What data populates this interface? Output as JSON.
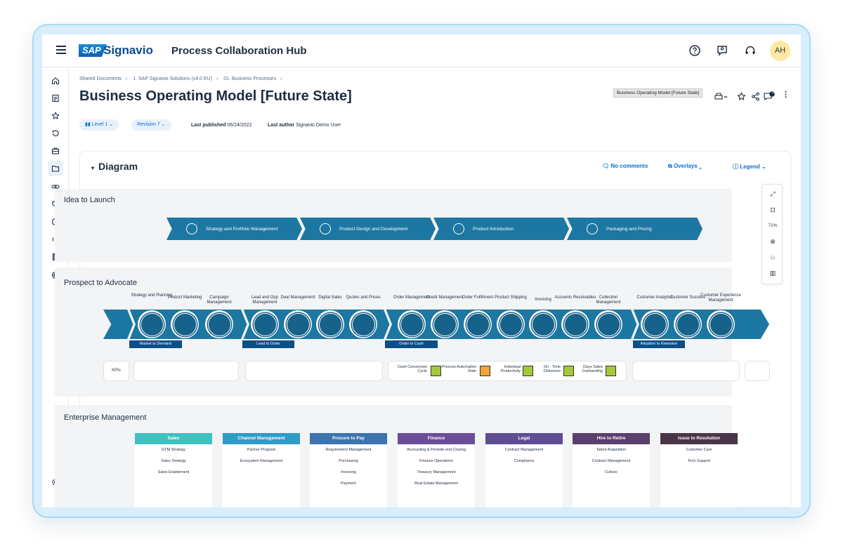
{
  "app": {
    "logo": "SAP",
    "brand": "Signavio",
    "title": "Process Collaboration Hub",
    "user_initials": "AH"
  },
  "header_icons": [
    "help-icon",
    "feedback-icon",
    "support-headset-icon"
  ],
  "sidebar_icons": [
    "home-icon",
    "document-icon",
    "star-icon",
    "history-icon",
    "briefcase-icon",
    "folder-icon",
    "link-icon",
    "search-analysis-icon",
    "dashboard-icon",
    "broadcast-icon",
    "book-icon",
    "globe-icon",
    "settings-icon"
  ],
  "breadcrumb": [
    "Shared Documents",
    "1. SAP Signavio Solutions (v4.0 EU)",
    "01. Business Processes"
  ],
  "page": {
    "title": "Business Operating Model [Future State]",
    "level_label": "Level",
    "level_value": "1",
    "revision_label": "Revision",
    "revision_value": "7",
    "published_label": "Last published",
    "published_value": "06/24/2022",
    "author_label": "Last author",
    "author_value": "Signavio Demo User",
    "tooltip": "Business Operating Model [Future State]",
    "comment_count": "0"
  },
  "diagram": {
    "heading": "Diagram",
    "comments": "No comments",
    "overlays": "Overlays",
    "legend": "Legend",
    "zoom": "71%"
  },
  "idea_to_launch": {
    "title": "Idea to Launch",
    "steps": [
      "Strategy and Portfolio Management",
      "Product Design and Development",
      "Product Introduction",
      "Packaging and Pricing"
    ]
  },
  "prospect_to_advocate": {
    "title": "Prospect to Advocate",
    "processes": [
      "Strategy and Planning",
      "Product Marketing",
      "Campaign Management",
      "Lead and Opp Management",
      "Deal Management",
      "Digital Sales",
      "Quotes and Prices",
      "Order Management",
      "Credit Management",
      "Order Fulfillment",
      "Product Shipping",
      "Invoicing",
      "Accounts Receivables",
      "Collection Management",
      "Customer Analytics",
      "Customer Success",
      "Customer Experience Management"
    ],
    "tags": [
      "Market to Demand",
      "Lead to Order",
      "Order to Cash",
      "Adoption to Retention"
    ],
    "kpi_label": "KPIs",
    "kpis": [
      {
        "name": "Cash Conversion Cycle",
        "status": "ok"
      },
      {
        "name": "Process Automation Rate",
        "status": "warning"
      },
      {
        "name": "Individual Productivity",
        "status": "ok"
      },
      {
        "name": "On - Time Deliveries",
        "status": "ok"
      },
      {
        "name": "Days Sales Outstanding",
        "status": "ok"
      }
    ]
  },
  "enterprise_management": {
    "title": "Enterprise Management",
    "columns": [
      {
        "title": "Sales",
        "color": "#3fc1c0",
        "items": [
          "GTM Strategy",
          "Sales Strategy",
          "Sales Enablement"
        ]
      },
      {
        "title": "Channel Management",
        "color": "#2d9cc8",
        "items": [
          "Partner Program",
          "Ecosystem Management"
        ]
      },
      {
        "title": "Procure to Pay",
        "color": "#3b74b0",
        "items": [
          "Requirement Management",
          "Purchasing",
          "Invoicing",
          "Payment"
        ]
      },
      {
        "title": "Finance",
        "color": "#6b4d9a",
        "items": [
          "Accounting & Periode-end Closing",
          "Finance Operations",
          "Treasury Management",
          "Real Estate Management"
        ]
      },
      {
        "title": "Legal",
        "color": "#5f4d94",
        "items": [
          "Contract Management",
          "Compliance"
        ]
      },
      {
        "title": "Hire to Retire",
        "color": "#5b3f6e",
        "items": [
          "Talent Acquisition",
          "Contract Management",
          "Culture"
        ]
      },
      {
        "title": "Issue to Resolution",
        "color": "#4a3548",
        "items": [
          "Customer Care",
          "Tech Support"
        ]
      }
    ]
  },
  "colors": {
    "accent": "#0a6ed1",
    "band": "#1c77a2",
    "tag": "#0b4f86",
    "ok": "#a4c939",
    "warning": "#f0a43a"
  }
}
